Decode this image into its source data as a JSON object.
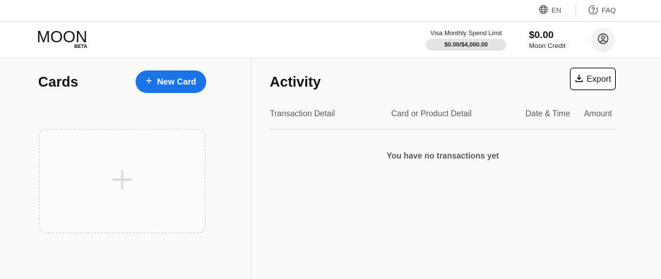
{
  "topbar": {
    "language": "EN",
    "faq": "FAQ",
    "icons": {
      "language": "globe-icon",
      "faq": "help-circle-icon"
    }
  },
  "header": {
    "logo_text": "MOON",
    "logo_badge": "BETA",
    "spend_limit_label": "Visa Monthly Spend Limit",
    "spend_limit_value": "$0.00/$4,000.00",
    "credit_amount": "$0.00",
    "credit_label": "Moon Credit",
    "user_icon": "user-circle-icon"
  },
  "cards": {
    "title": "Cards",
    "new_card_label": "New Card",
    "add_card_icon": "plus-icon"
  },
  "activity": {
    "title": "Activity",
    "export_label": "Export",
    "columns": [
      "Transaction Detail",
      "Card or Product Detail",
      "Date & Time",
      "Amount"
    ],
    "empty_message": "You have no transactions yet"
  },
  "colors": {
    "accent": "#1a73e8",
    "background": "#fafafa"
  }
}
